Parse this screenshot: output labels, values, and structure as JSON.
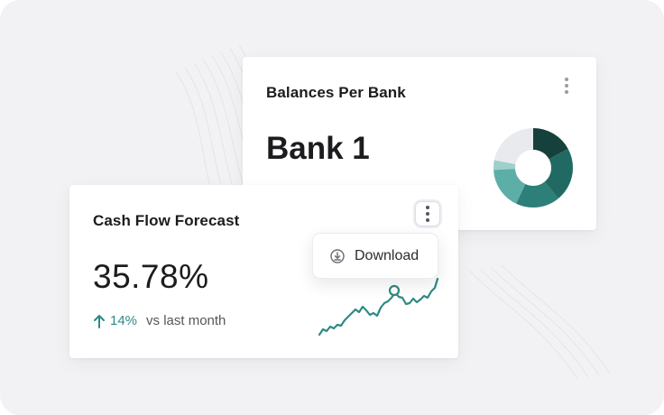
{
  "colors": {
    "background": "#f2f2f4",
    "card": "#ffffff",
    "accent_teal": "#2d8a84",
    "text_primary": "#1c1c1f",
    "text_secondary": "#55565e"
  },
  "balances_card": {
    "title": "Balances Per Bank",
    "bank_name": "Bank 1",
    "menu_icon": "vertical-ellipsis-icon",
    "donut_colors": [
      "#16403c",
      "#216a63",
      "#2d7f79",
      "#5daea6",
      "#9ed0cb",
      "#e9eaee"
    ]
  },
  "cashflow_card": {
    "title": "Cash Flow Forecast",
    "value": "35.78%",
    "trend_icon": "arrow-up-icon",
    "change": "14%",
    "change_label": "vs last month",
    "menu_icon": "vertical-ellipsis-icon"
  },
  "context_menu": {
    "items": [
      {
        "label": "Download",
        "icon": "download-icon"
      }
    ]
  }
}
